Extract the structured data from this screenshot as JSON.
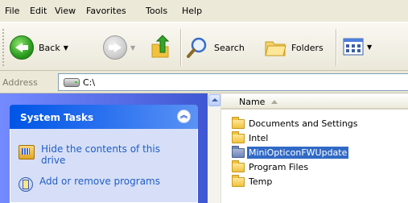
{
  "menu": [
    "File",
    "Edit",
    "View",
    "Favorites",
    "Tools",
    "Help"
  ],
  "toolbar": {
    "back_label": "Back",
    "search_label": "Search",
    "folders_label": "Folders"
  },
  "address": {
    "label": "Address",
    "path": "C:\\"
  },
  "tasks_panel": {
    "title": "System Tasks",
    "items": [
      {
        "label": "Hide the contents of this drive"
      },
      {
        "label": "Add or remove programs"
      }
    ]
  },
  "file_list": {
    "column_name": "Name",
    "items": [
      {
        "name": "Documents and Settings",
        "selected": false
      },
      {
        "name": "Intel",
        "selected": false
      },
      {
        "name": "MiniOpticonFWUpdate",
        "selected": true
      },
      {
        "name": "Program Files",
        "selected": false
      },
      {
        "name": "Temp",
        "selected": false
      }
    ]
  },
  "colors": {
    "selection": "#316ac5",
    "task_link": "#215dc6",
    "pane_header": "#0055e5"
  }
}
